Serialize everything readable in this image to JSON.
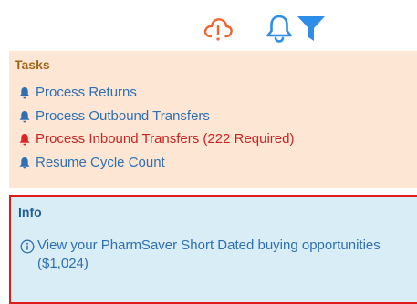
{
  "toolbar": {
    "icons": [
      "cloud-alert-icon",
      "bell-icon",
      "filter-icon"
    ],
    "colors": {
      "cloud": "#f0642d",
      "bell": "#2c8ee8",
      "filter": "#2c8ee8"
    }
  },
  "tasks": {
    "title": "Tasks",
    "items": [
      {
        "label": "Process Returns",
        "icon": "bell-icon",
        "color": "#2f6fb4"
      },
      {
        "label": "Process Outbound Transfers",
        "icon": "bell-icon",
        "color": "#2f6fb4"
      },
      {
        "label": "Process Inbound Transfers (222 Required)",
        "icon": "bell-icon",
        "color": "#d92525"
      },
      {
        "label": "Resume Cycle Count",
        "icon": "bell-icon",
        "color": "#2f6fb4"
      }
    ]
  },
  "info": {
    "title": "Info",
    "items": [
      {
        "label": "View your PharmSaver Short Dated buying opportunities ($1,024)",
        "icon": "info-icon"
      }
    ]
  }
}
